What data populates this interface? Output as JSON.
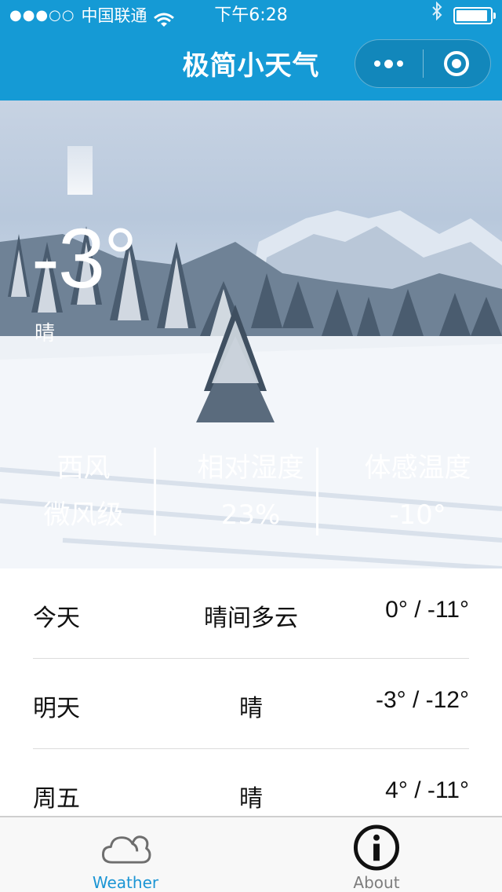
{
  "status_bar": {
    "signal": "●●●○○",
    "carrier": "中国联通",
    "time": "下午6:28",
    "battery_level": 0.92
  },
  "nav": {
    "title": "极简小天气",
    "background_color": "#159ad5"
  },
  "current": {
    "temperature": "-3°",
    "condition": "晴"
  },
  "stats": [
    {
      "line1": "西风",
      "line2": "微风级"
    },
    {
      "line1": "相对湿度",
      "line2": "23%"
    },
    {
      "line1": "体感温度",
      "line2": "-10°"
    }
  ],
  "forecast": [
    {
      "day": "今天",
      "desc": "晴间多云",
      "range": "0° / -11°"
    },
    {
      "day": "明天",
      "desc": "晴",
      "range": "-3° / -12°"
    },
    {
      "day": "周五",
      "desc": "晴",
      "range": "4° / -11°"
    }
  ],
  "tabs": [
    {
      "label": "Weather",
      "icon": "cloud-icon",
      "active": true,
      "active_color": "#1b95d4"
    },
    {
      "label": "About",
      "icon": "info-icon",
      "active": false,
      "color": "#7d7d7d"
    }
  ]
}
